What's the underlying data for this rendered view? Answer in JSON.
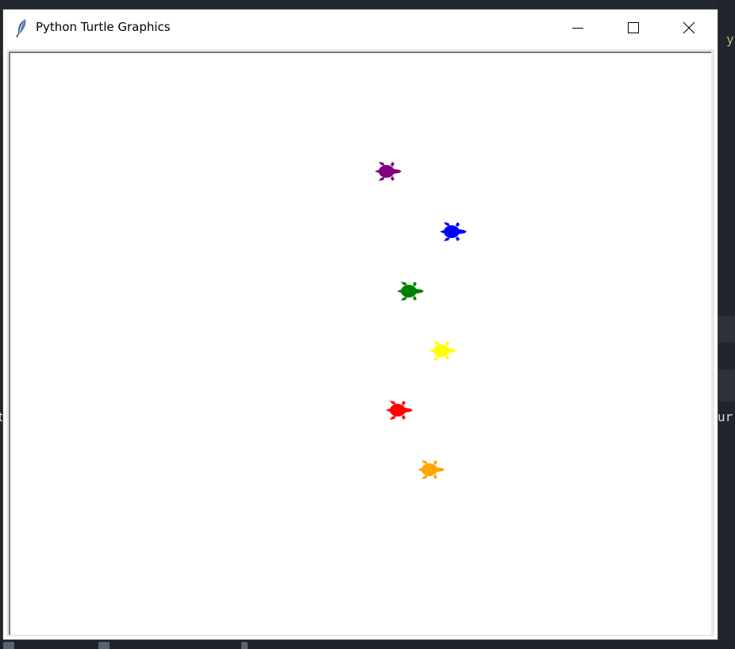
{
  "window": {
    "title": "Python Turtle Graphics"
  },
  "controls": {
    "minimize_icon": "minimize-icon",
    "maximize_icon": "maximize-icon",
    "close_icon": "close-icon"
  },
  "app_icon": "feather-icon",
  "turtles": [
    {
      "name": "purple-turtle",
      "color": "#800080"
    },
    {
      "name": "blue-turtle",
      "color": "#0000ff"
    },
    {
      "name": "green-turtle",
      "color": "#008000"
    },
    {
      "name": "yellow-turtle",
      "color": "#ffff00"
    },
    {
      "name": "red-turtle",
      "color": "#ff0000"
    },
    {
      "name": "orange-turtle",
      "color": "#ffa500"
    }
  ],
  "background": {
    "right_text_1": "y",
    "right_text_2": "ur",
    "left_text": "t"
  }
}
